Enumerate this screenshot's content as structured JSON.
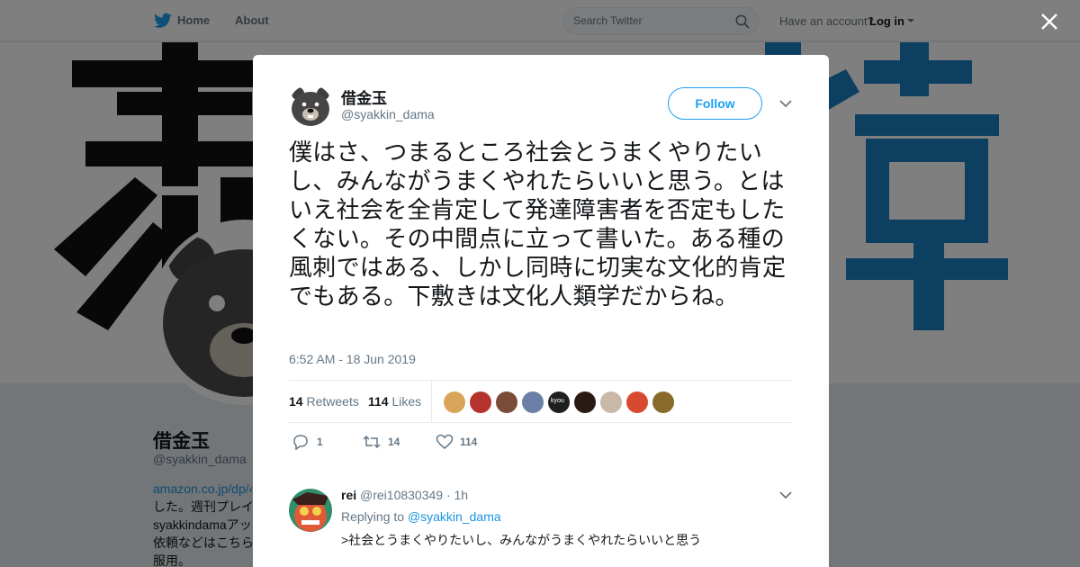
{
  "nav": {
    "home": "Home",
    "about": "About",
    "search_placeholder": "Search Twitter",
    "have_account": "Have an account?",
    "login": "Log in"
  },
  "profile": {
    "name": "借金玉",
    "handle": "@syakkin_dama",
    "bio_lines": [
      "amazon.co.jp/dp/4",
      "した。週刊プレイ",
      "syakkindamaアッ",
      "依頼などはこちら",
      "服用。"
    ]
  },
  "tweet": {
    "author_name": "借金玉",
    "author_handle": "@syakkin_dama",
    "follow_label": "Follow",
    "text": "僕はさ、つまるところ社会とうまくやりたいし、みんながうまくやれたらいいと思う。とはいえ社会を全肯定して発達障害者を否定もしたくない。その中間点に立って書いた。ある種の風刺ではある、しかし同時に切実な文化的肯定でもある。下敷きは文化人類学だからね。",
    "timestamp": "6:52 AM - 18 Jun 2019",
    "retweets_count": "14",
    "retweets_label": "Retweets",
    "likes_count": "114",
    "likes_label": "Likes",
    "liker_avatars": [
      "#d9a55b",
      "#b5322d",
      "#7a4b36",
      "#6b7fa8",
      "#1f1f1f",
      "#2a1a14",
      "#c9b8a8",
      "#d84a2f",
      "#8a6a2a"
    ],
    "liker_avatar_label": "kyou",
    "actions": {
      "replies": "1",
      "retweets": "14",
      "likes": "114"
    }
  },
  "reply": {
    "name": "rei",
    "handle": "@rei10830349",
    "time": "· 1h",
    "replying_to_label": "Replying to",
    "replying_to_mention": "@syakkin_dama",
    "text": ">社会とうまくやりたいし、みんながうまくやれたらいいと思う"
  },
  "colors": {
    "twitter_blue": "#1da1f2",
    "link_blue": "#1b95e0",
    "banner_blue": "#1b7ec0",
    "text_dark": "#14171a",
    "text_gray": "#657786"
  },
  "icons": [
    "twitter-bird-icon",
    "search-icon",
    "caret-down-icon",
    "close-icon",
    "reply-icon",
    "retweet-icon",
    "like-icon"
  ]
}
